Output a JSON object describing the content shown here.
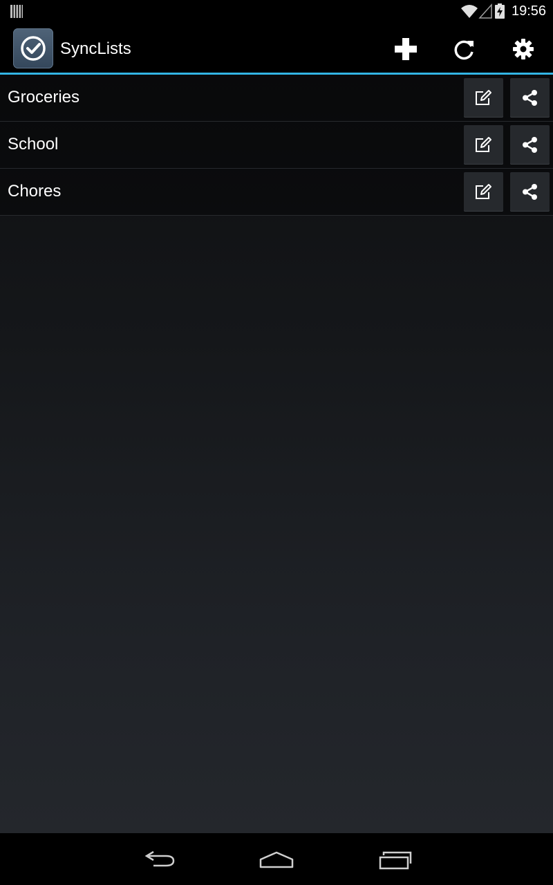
{
  "status_bar": {
    "time": "19:56",
    "icons": [
      "storage-icon",
      "wifi-icon",
      "cell-signal-icon",
      "battery-charging-icon"
    ]
  },
  "action_bar": {
    "title": "SyncLists",
    "app_icon": "checkmark-icon",
    "actions": [
      "add-icon",
      "refresh-icon",
      "settings-icon"
    ],
    "accent_color": "#33b5e5"
  },
  "lists": {
    "items": [
      {
        "label": "Groceries"
      },
      {
        "label": "School"
      },
      {
        "label": "Chores"
      }
    ],
    "item_actions": [
      "edit-icon",
      "share-icon"
    ]
  },
  "nav_bar": {
    "buttons": [
      "back-icon",
      "home-icon",
      "recent-apps-icon"
    ]
  }
}
